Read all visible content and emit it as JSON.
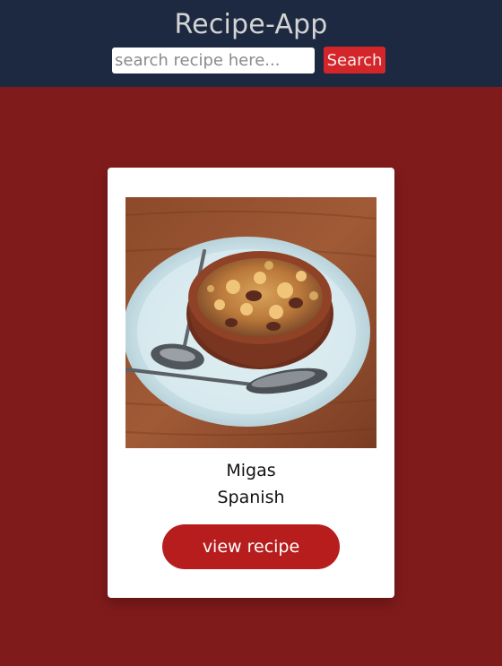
{
  "header": {
    "title": "Recipe-App",
    "search_placeholder": "search recipe here...",
    "search_value": "",
    "search_button_label": "Search"
  },
  "recipe": {
    "name": "Migas",
    "area": "Spanish",
    "view_button_label": "view recipe",
    "image_description_icon": "food-photo"
  },
  "colors": {
    "page_background": "#801b1b",
    "header_background": "#1c2940",
    "search_button": "#d4262a",
    "view_button": "#b81d1d",
    "card_background": "#ffffff"
  }
}
